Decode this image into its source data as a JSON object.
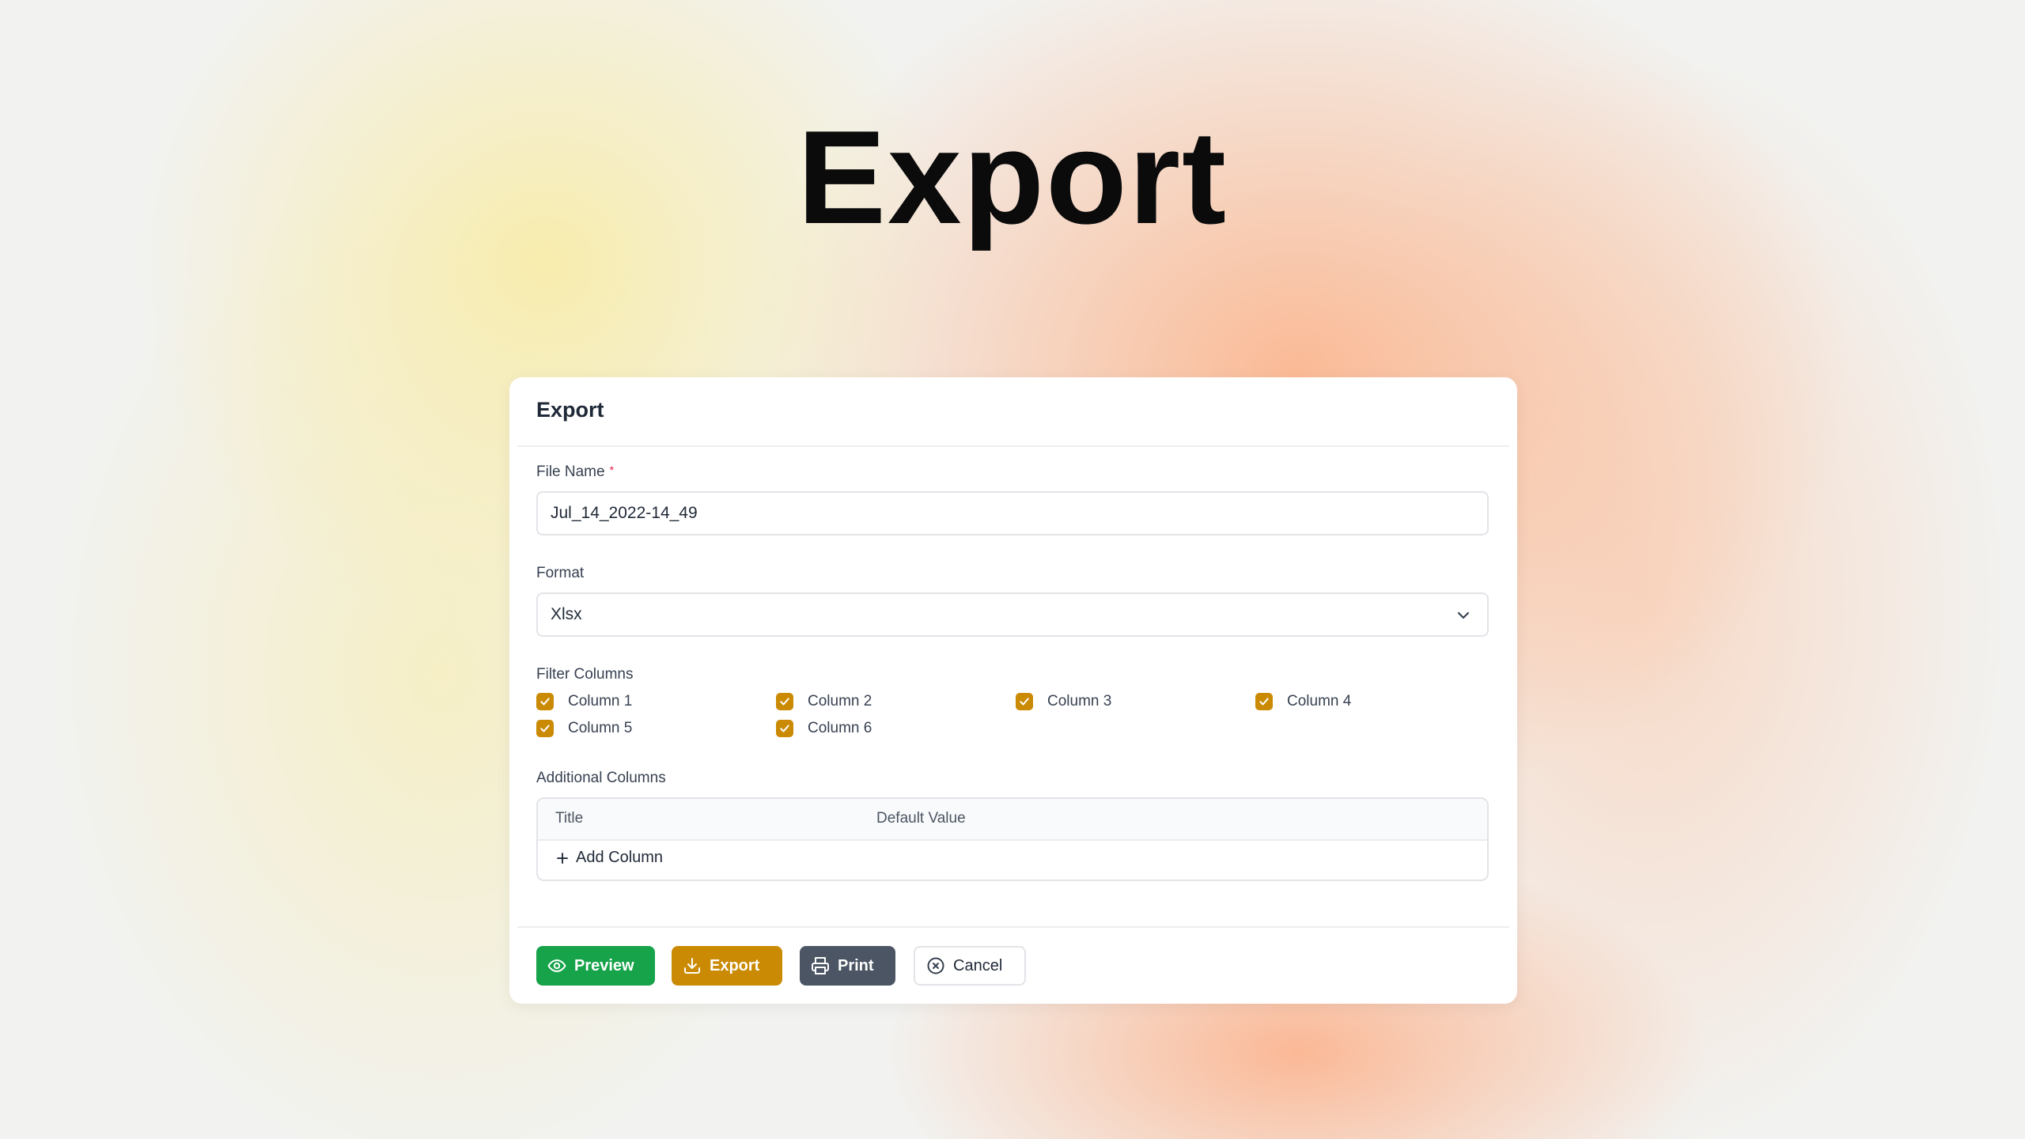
{
  "page": {
    "title": "Export"
  },
  "modal": {
    "title": "Export",
    "file_name": {
      "label": "File Name",
      "required_mark": "*",
      "value": "Jul_14_2022-14_49"
    },
    "format": {
      "label": "Format",
      "selected": "Xlsx"
    },
    "filter_columns": {
      "label": "Filter Columns",
      "items": [
        {
          "label": "Column 1",
          "checked": true
        },
        {
          "label": "Column 2",
          "checked": true
        },
        {
          "label": "Column 3",
          "checked": true
        },
        {
          "label": "Column 4",
          "checked": true
        },
        {
          "label": "Column 5",
          "checked": true
        },
        {
          "label": "Column 6",
          "checked": true
        }
      ]
    },
    "additional_columns": {
      "label": "Additional Columns",
      "headers": [
        "Title",
        "Default Value"
      ],
      "add_label": "Add Column"
    },
    "buttons": {
      "preview": "Preview",
      "export": "Export",
      "print": "Print",
      "cancel": "Cancel"
    }
  },
  "colors": {
    "preview": "#16a34a",
    "export": "#ca8a04",
    "print": "#4b5563",
    "checkbox": "#ca8a04",
    "required": "#e11d48"
  },
  "icons": {
    "preview": "eye-icon",
    "export": "download-icon",
    "print": "printer-icon",
    "cancel": "close-circle-icon",
    "select": "chevron-down-icon",
    "add": "plus-icon",
    "checkbox": "check-icon"
  }
}
